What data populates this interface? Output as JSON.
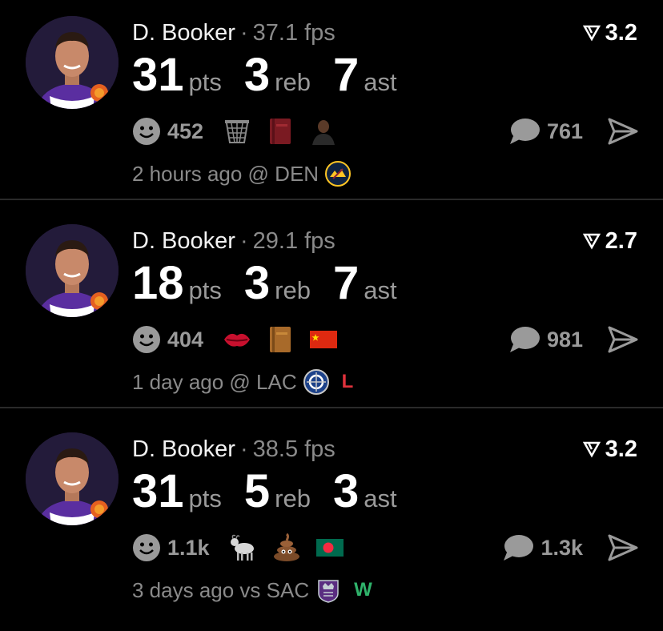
{
  "posts": [
    {
      "player": "D. Booker",
      "fps": "37.1 fps",
      "rating": "3.2",
      "pts": "31",
      "pts_label": "pts",
      "reb": "3",
      "reb_label": "reb",
      "ast": "7",
      "ast_label": "ast",
      "reactions": "452",
      "emojis": [
        "basketball-hoop-icon",
        "red-book-icon",
        "person-icon"
      ],
      "comments": "761",
      "meta": "2 hours ago @ DEN",
      "team_logo": "nuggets-logo-icon",
      "result": ""
    },
    {
      "player": "D. Booker",
      "fps": "29.1 fps",
      "rating": "2.7",
      "pts": "18",
      "pts_label": "pts",
      "reb": "3",
      "reb_label": "reb",
      "ast": "7",
      "ast_label": "ast",
      "reactions": "404",
      "emojis": [
        "kiss-lips-icon",
        "brown-book-icon",
        "china-flag-icon"
      ],
      "comments": "981",
      "meta": "1 day ago @ LAC",
      "team_logo": "clippers-logo-icon",
      "result": "L",
      "result_color": "#e0323c"
    },
    {
      "player": "D. Booker",
      "fps": "38.5 fps",
      "rating": "3.2",
      "pts": "31",
      "pts_label": "pts",
      "reb": "5",
      "reb_label": "reb",
      "ast": "3",
      "ast_label": "ast",
      "reactions": "1.1k",
      "emojis": [
        "goat-icon",
        "poop-icon",
        "bangladesh-flag-icon"
      ],
      "comments": "1.3k",
      "meta": "3 days ago vs SAC",
      "team_logo": "kings-logo-icon",
      "result": "W",
      "result_color": "#2fb36b"
    }
  ]
}
